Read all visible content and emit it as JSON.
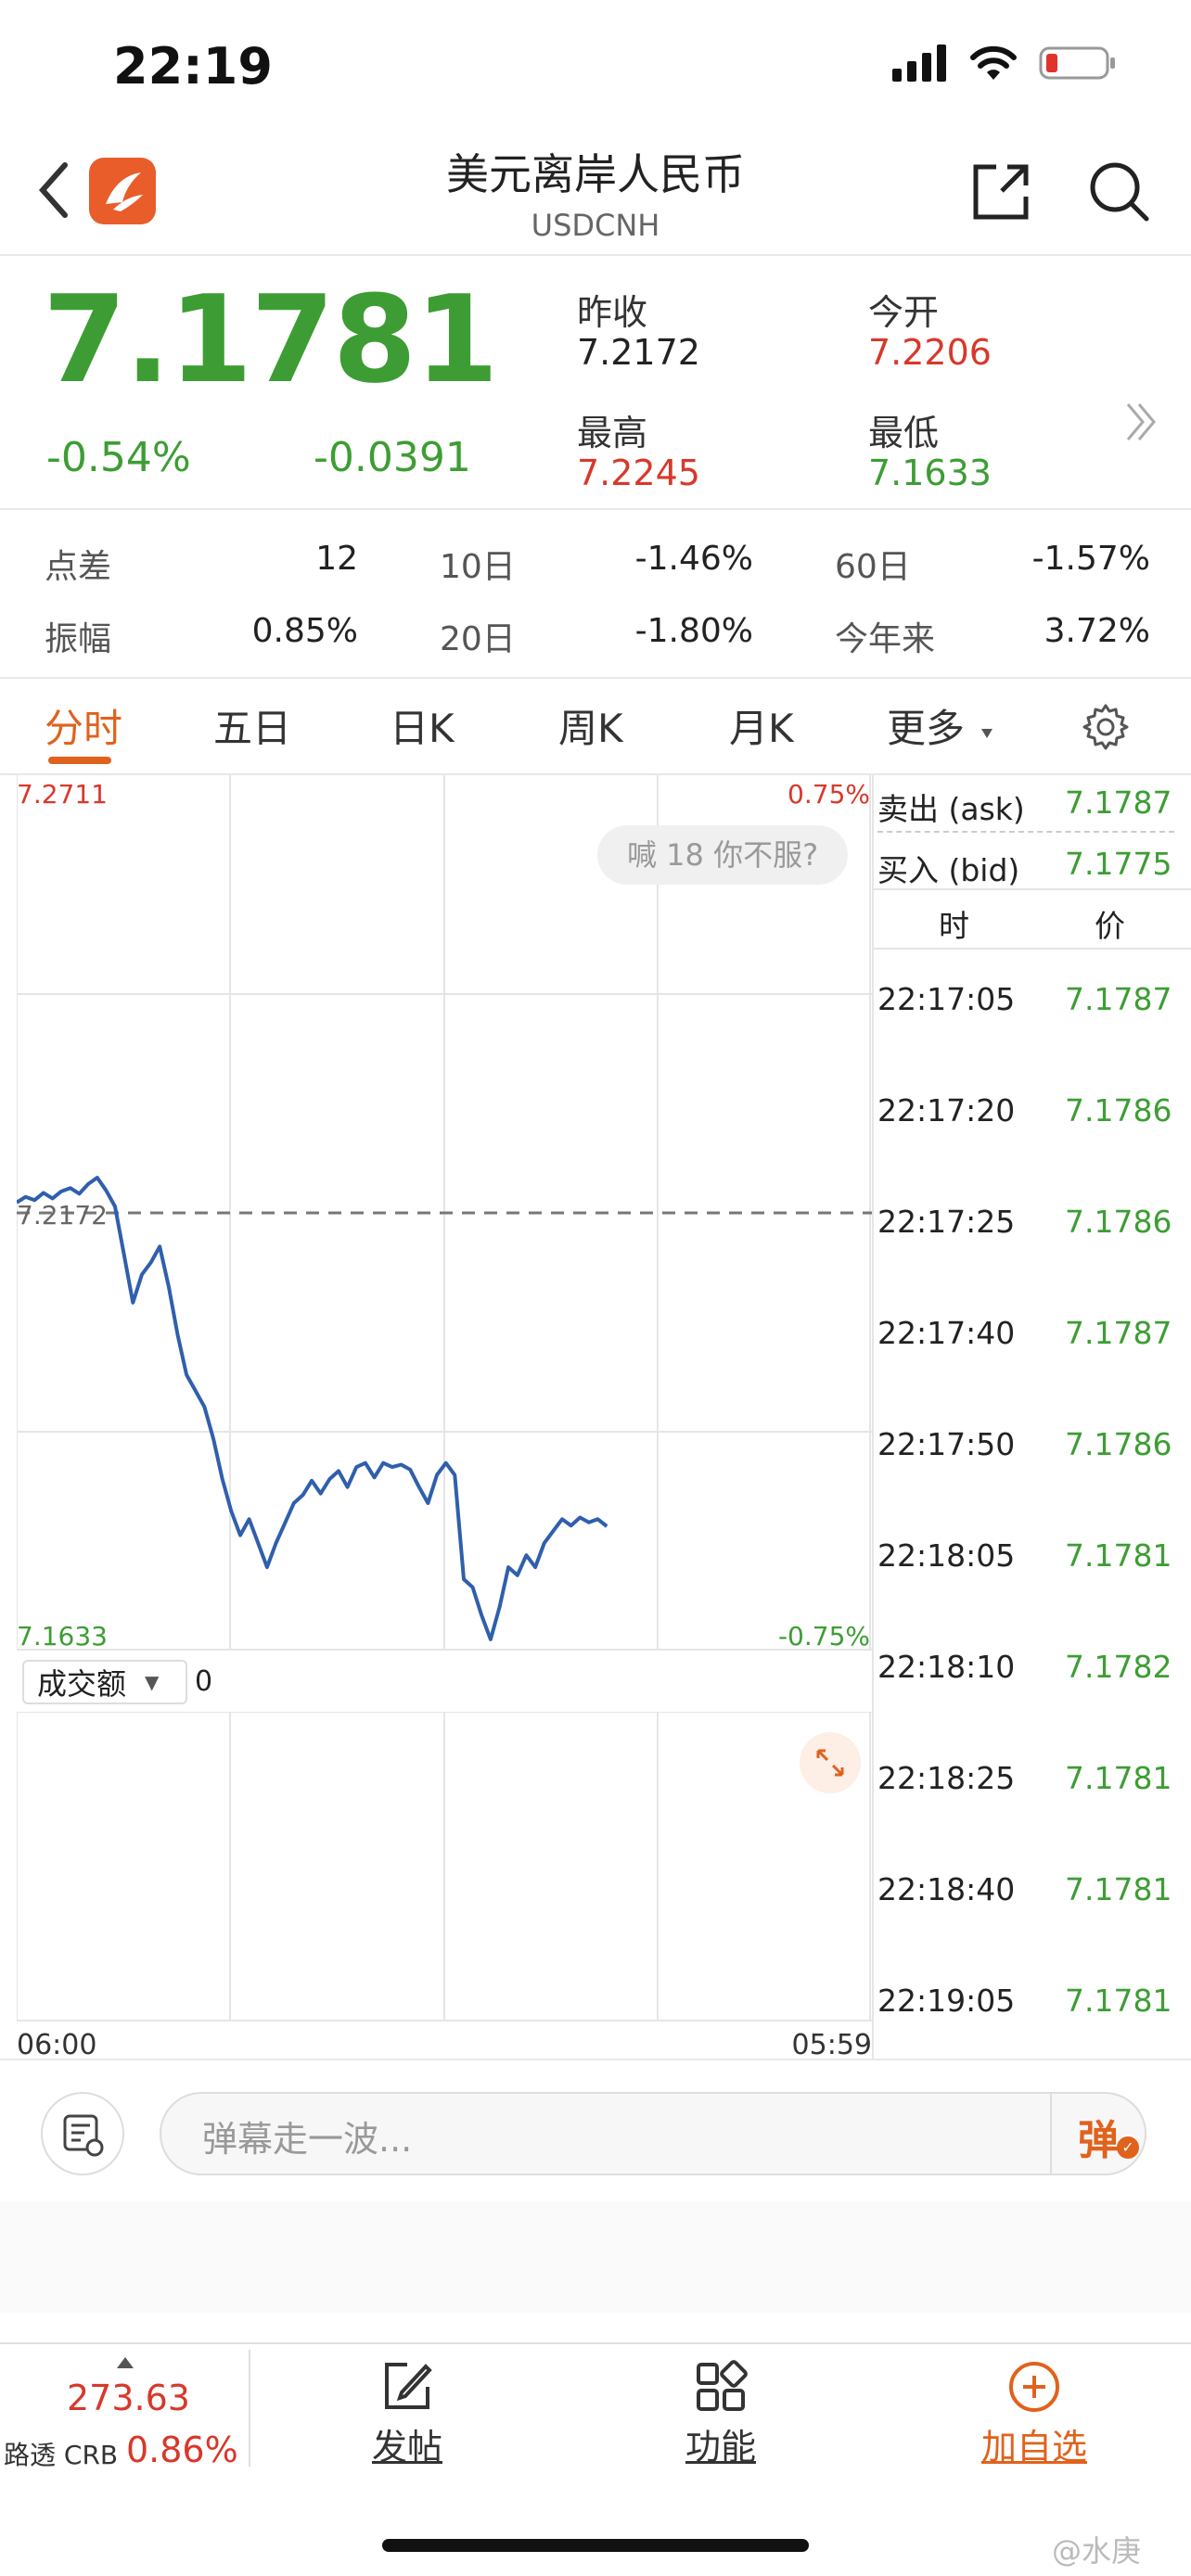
{
  "status": {
    "time": "22:19"
  },
  "header": {
    "title": "美元离岸人民币",
    "subtitle": "USDCNH"
  },
  "quote": {
    "price": "7.1781",
    "change_pct": "-0.54%",
    "change": "-0.0391",
    "prev_close_label": "昨收",
    "prev_close": "7.2172",
    "open_label": "今开",
    "open": "7.2206",
    "high_label": "最高",
    "high": "7.2245",
    "low_label": "最低",
    "low": "7.1633"
  },
  "stats": {
    "spread_label": "点差",
    "spread": "12",
    "d10_label": "10日",
    "d10": "-1.46%",
    "d60_label": "60日",
    "d60": "-1.57%",
    "amp_label": "振幅",
    "amp": "0.85%",
    "d20_label": "20日",
    "d20": "-1.80%",
    "ytd_label": "今年来",
    "ytd": "3.72%"
  },
  "tabs": [
    "分时",
    "五日",
    "日K",
    "周K",
    "月K",
    "更多"
  ],
  "chart": {
    "y_high": "7.2711",
    "y_high_pct": "0.75%",
    "y_low": "7.1633",
    "y_low_pct": "-0.75%",
    "ref_label": "7.2172",
    "tooltip": "喊 18 你不服?",
    "volume_label": "成交额",
    "volume_value": "0",
    "x_start": "06:00",
    "x_end": "05:59"
  },
  "chart_data": {
    "type": "line",
    "series": [
      {
        "values": [
          7.2185,
          7.2192,
          7.2188,
          7.2197,
          7.219,
          7.2199,
          7.2203,
          7.2196,
          7.2208,
          7.2216,
          7.22,
          7.218,
          7.212,
          7.206,
          7.2095,
          7.211,
          7.213,
          7.208,
          7.202,
          7.197,
          7.195,
          7.193,
          7.189,
          7.184,
          7.18,
          7.177,
          7.179,
          7.176,
          7.173,
          7.176,
          7.1785,
          7.181,
          7.182,
          7.1838,
          7.1822,
          7.184,
          7.185,
          7.183,
          7.1855,
          7.186,
          7.1842,
          7.186,
          7.1855,
          7.1858,
          7.1852,
          7.183,
          7.181,
          7.1845,
          7.186,
          7.1845,
          7.1715,
          7.1705,
          7.167,
          7.164,
          7.168,
          7.173,
          7.172,
          7.1745,
          7.173,
          7.176,
          7.1775,
          7.179,
          7.1782,
          7.1792,
          7.1786,
          7.179,
          7.1781
        ]
      }
    ],
    "ylim": [
      7.1633,
      7.2711
    ],
    "reference": 7.2172,
    "grid": true
  },
  "book": {
    "ask_label": "卖出 (ask)",
    "ask": "7.1787",
    "bid_label": "买入 (bid)",
    "bid": "7.1775",
    "col_time": "时",
    "col_price": "价",
    "ticks": [
      {
        "t": "22:17:05",
        "p": "7.1787"
      },
      {
        "t": "22:17:20",
        "p": "7.1786"
      },
      {
        "t": "22:17:25",
        "p": "7.1786"
      },
      {
        "t": "22:17:40",
        "p": "7.1787"
      },
      {
        "t": "22:17:50",
        "p": "7.1786"
      },
      {
        "t": "22:18:05",
        "p": "7.1781"
      },
      {
        "t": "22:18:10",
        "p": "7.1782"
      },
      {
        "t": "22:18:25",
        "p": "7.1781"
      },
      {
        "t": "22:18:40",
        "p": "7.1781"
      },
      {
        "t": "22:19:05",
        "p": "7.1781"
      }
    ]
  },
  "danmu": {
    "placeholder": "弹幕走一波...",
    "send": "弹"
  },
  "bottom": {
    "index_value": "273.63",
    "index_name": "路透 CRB",
    "index_pct": "0.86%",
    "post": "发帖",
    "func": "功能",
    "watch": "加自选"
  },
  "watermark": "@水庚",
  "colors": {
    "up": "#d8382b",
    "down": "#3d9d34",
    "accent": "#e0621d",
    "line": "#2f5fad"
  }
}
